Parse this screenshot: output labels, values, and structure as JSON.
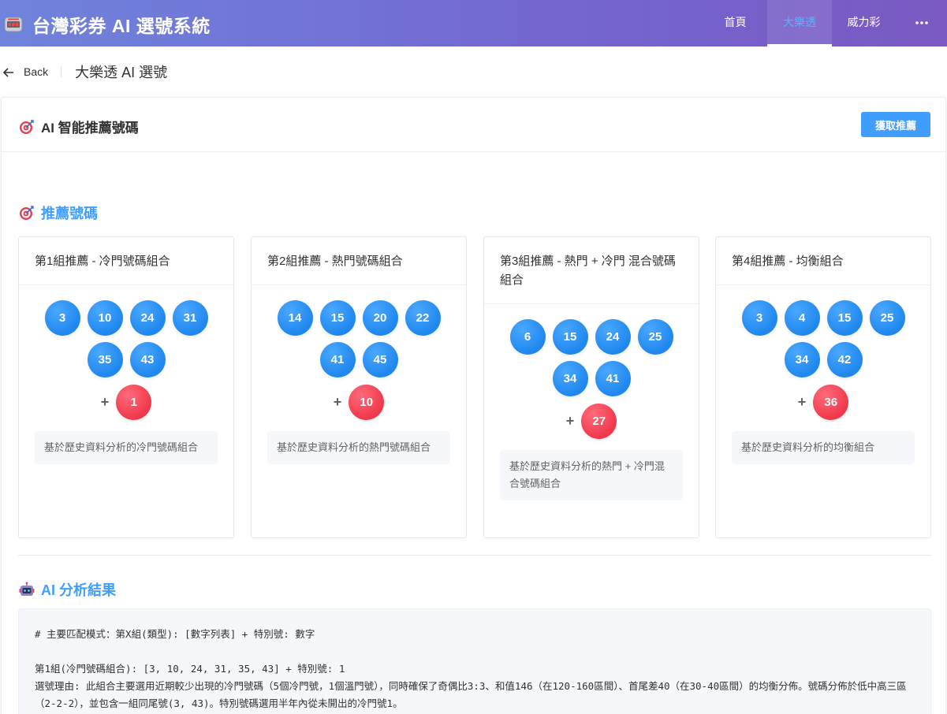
{
  "header": {
    "title": "台灣彩券 AI 選號系統",
    "brand_icon": "slot-machine-icon",
    "nav": [
      {
        "label": "首頁",
        "active": false
      },
      {
        "label": "大樂透",
        "active": true
      },
      {
        "label": "威力彩",
        "active": false
      }
    ],
    "more_icon": "ellipsis-icon"
  },
  "page_header": {
    "back_label": "Back",
    "title": "大樂透 AI 選號"
  },
  "card": {
    "title": "AI 智能推薦號碼",
    "button_label": "獲取推薦"
  },
  "recommend": {
    "title": "推薦號碼",
    "groups": [
      {
        "title": "第1組推薦 - 冷門號碼組合",
        "numbers": [
          "3",
          "10",
          "24",
          "31",
          "35",
          "43"
        ],
        "special": "1",
        "reason": "基於歷史資料分析的冷門號碼組合"
      },
      {
        "title": "第2組推薦 - 熱門號碼組合",
        "numbers": [
          "14",
          "15",
          "20",
          "22",
          "41",
          "45"
        ],
        "special": "10",
        "reason": "基於歷史資料分析的熱門號碼組合"
      },
      {
        "title": "第3組推薦 - 熱門 + 冷門 混合號碼組合",
        "numbers": [
          "6",
          "15",
          "24",
          "25",
          "34",
          "41"
        ],
        "special": "27",
        "reason": "基於歷史資料分析的熱門 + 冷門混合號碼組合"
      },
      {
        "title": "第4組推薦 - 均衡組合",
        "numbers": [
          "3",
          "4",
          "15",
          "25",
          "34",
          "42"
        ],
        "special": "36",
        "reason": "基於歷史資料分析的均衡組合"
      }
    ]
  },
  "analysis": {
    "title": "AI 分析結果",
    "lines": [
      "# 主要匹配模式：第X組(類型): [數字列表] + 特別號: 數字",
      "",
      "第1組(冷門號碼組合): [3, 10, 24, 31, 35, 43] + 特別號: 1",
      "選號理由: 此組合主要選用近期較少出現的冷門號碼（5個冷門號，1個溫門號），同時確保了奇偶比3:3、和值146（在120-160區間）、首尾差40（在30-40區間）的均衡分佈。號碼分佈於低中高三區（2-2-2），並包含一組同尾號(3, 43)。特別號碼選用半年內從未開出的冷門號1。"
    ]
  },
  "colors": {
    "header_gradient_start": "#6f83dc",
    "header_gradient_end": "#7a59c2",
    "primary": "#409eff",
    "ball_blue": "#1f87ee",
    "ball_red": "#f0384b"
  }
}
